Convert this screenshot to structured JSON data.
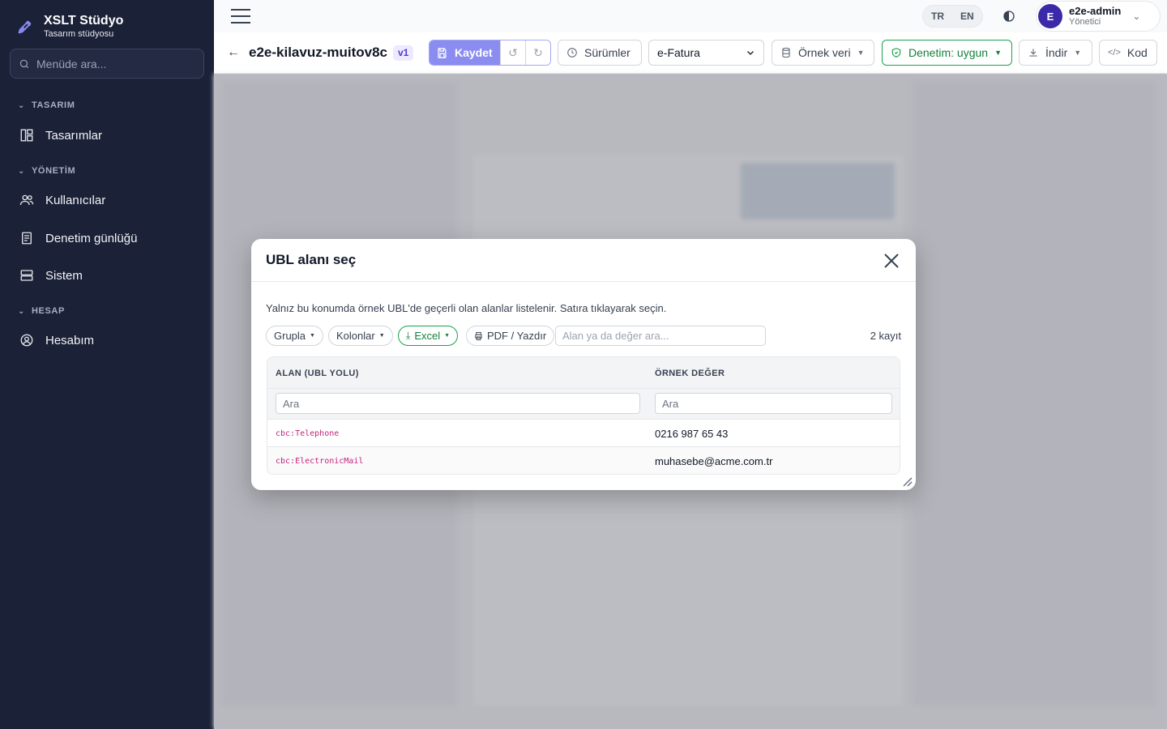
{
  "brand": {
    "title": "XSLT Stüdyo",
    "subtitle": "Tasarım stüdyosu"
  },
  "sidebar": {
    "search_placeholder": "Menüde ara...",
    "sections": [
      {
        "label": "TASARIM",
        "items": [
          {
            "label": "Tasarımlar",
            "icon": "layout-icon"
          }
        ]
      },
      {
        "label": "YÖNETİM",
        "items": [
          {
            "label": "Kullanıcılar",
            "icon": "users-icon"
          },
          {
            "label": "Denetim günlüğü",
            "icon": "log-icon"
          },
          {
            "label": "Sistem",
            "icon": "server-icon"
          }
        ]
      },
      {
        "label": "HESAP",
        "items": [
          {
            "label": "Hesabım",
            "icon": "user-circle-icon"
          }
        ]
      }
    ]
  },
  "topbar": {
    "lang_tr": "TR",
    "lang_en": "EN",
    "user_initial": "E",
    "user_name": "e2e-admin",
    "user_role": "Yönetici"
  },
  "toolbar": {
    "doc_title": "e2e-kilavuz-muitov8c",
    "version": "v1",
    "save_label": "Kaydet",
    "versions_label": "Sürümler",
    "doc_type": "e-Fatura",
    "sample_label": "Örnek veri",
    "audit_label": "Denetim: uygun",
    "download_label": "İndir",
    "code_label": "Kod"
  },
  "modal": {
    "title": "UBL alanı seç",
    "description": "Yalnız bu konumda örnek UBL'de geçerli olan alanlar listelenir. Satıra tıklayarak seçin.",
    "group_label": "Grupla",
    "columns_label": "Kolonlar",
    "excel_label": "Excel",
    "pdf_label": "PDF / Yazdır",
    "filter_placeholder": "Alan ya da değer ara...",
    "count": "2 kayıt",
    "col_field": "ALAN (UBL YOLU)",
    "col_sample": "ÖRNEK DEĞER",
    "filter_field_placeholder": "Ara",
    "filter_sample_placeholder": "Ara",
    "rows": [
      {
        "path": "cbc:Telephone",
        "value": "0216 987 65 43"
      },
      {
        "path": "cbc:ElectronicMail",
        "value": "muhasebe@acme.com.tr"
      }
    ]
  },
  "colors": {
    "sidebar_bg": "#1b2238",
    "accent": "#8b8cf0",
    "success": "#16a34a",
    "path_text": "#c0267a"
  }
}
